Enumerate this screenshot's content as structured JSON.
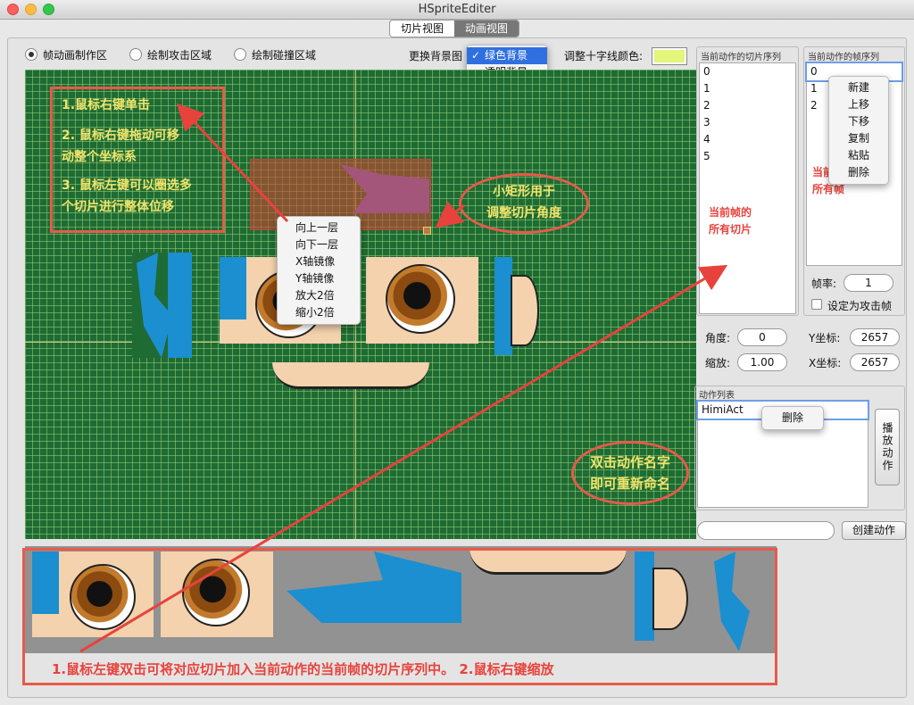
{
  "window": {
    "title": "HSpriteEditer"
  },
  "view_tabs": [
    {
      "label": "切片视图"
    },
    {
      "label": "动画视图"
    }
  ],
  "modes": [
    {
      "label": "帧动画制作区"
    },
    {
      "label": "绘制攻击区域"
    },
    {
      "label": "绘制碰撞区域"
    }
  ],
  "background": {
    "label": "更换背景图",
    "options": [
      "绿色背景",
      "透明背景"
    ]
  },
  "crosshair": {
    "label": "调整十字线颜色:",
    "color": "#e3f57a"
  },
  "slice_menu": [
    "向上一层",
    "向下一层",
    "X轴镜像",
    "Y轴镜像",
    "放大2倍",
    "缩小2倍"
  ],
  "canvas_notes": {
    "n1": "1.鼠标右键单击",
    "n2a": "2. 鼠标右键拖动可移",
    "n2b": "动整个坐标系",
    "n3a": "3. 鼠标左键可以圈选多",
    "n3b": "个切片进行整体位移",
    "rect1": "小矩形用于",
    "rect2": "调整切片角度"
  },
  "slice_panel": {
    "title": "当前动作的切片序列",
    "items": [
      "0",
      "1",
      "2",
      "3",
      "4",
      "5"
    ],
    "note1": "当前帧的",
    "note2": "所有切片"
  },
  "frame_panel": {
    "title": "当前动作的帧序列",
    "items": [
      "0",
      "1",
      "2"
    ],
    "menu": [
      "新建",
      "上移",
      "下移",
      "复制",
      "粘贴",
      "删除"
    ],
    "note1": "当前动作的",
    "note2": "所有帧"
  },
  "frame_rate": {
    "label": "帧率:",
    "value": "1"
  },
  "attack_frame": {
    "label": "设定为攻击帧"
  },
  "transform": {
    "angle_label": "角度:",
    "angle": "0",
    "scale_label": "缩放:",
    "scale": "1.00",
    "y_label": "Y坐标:",
    "y": "2657",
    "x_label": "X坐标:",
    "x": "2657"
  },
  "action_list": {
    "title": "动作列表",
    "items": [
      "HimiAct"
    ],
    "menu": [
      "删除"
    ],
    "note1": "双击动作名字",
    "note2": "即可重新命名"
  },
  "play_button": "播放动作",
  "create_action": {
    "value": "",
    "label": "创建动作"
  },
  "strip_note": "1.鼠标左键双击可将对应切片加入当前动作的当前帧的切片序列中。 2.鼠标右键缩放"
}
